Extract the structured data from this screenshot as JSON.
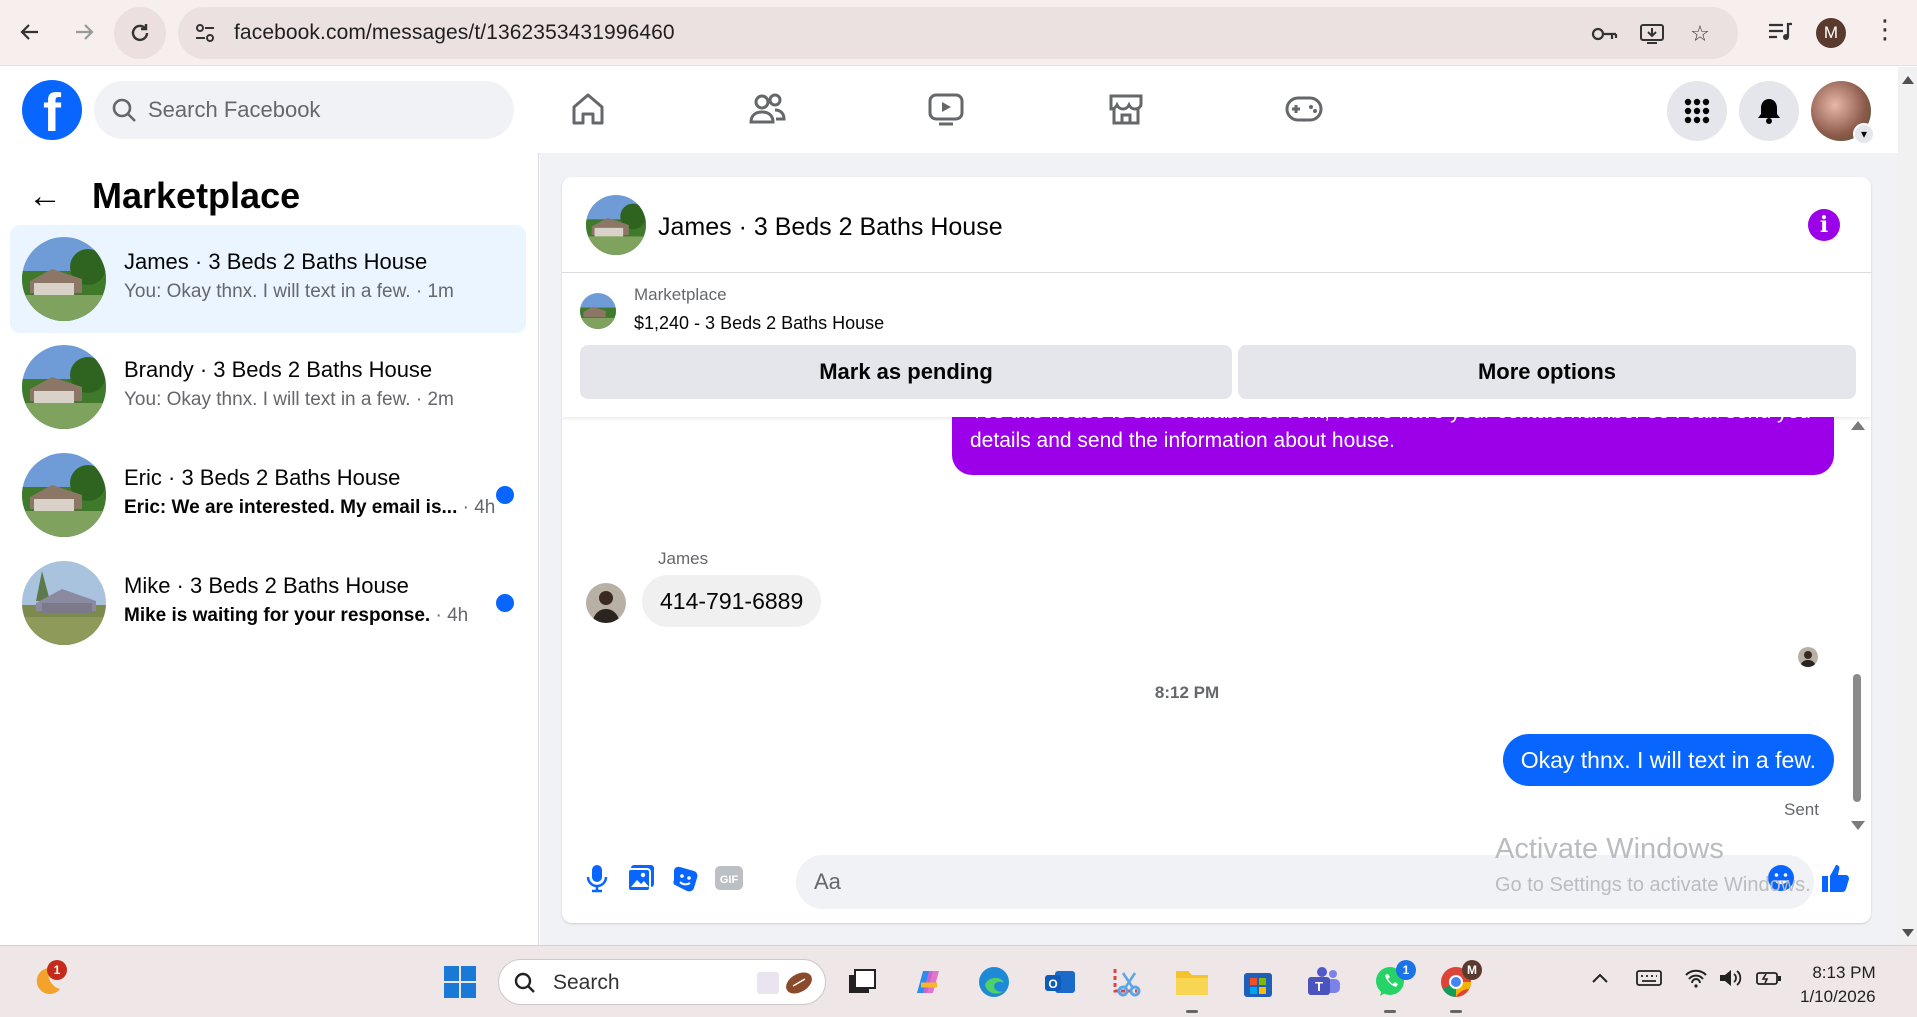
{
  "browser": {
    "url": "facebook.com/messages/t/1362353431996460",
    "profile_initial": "M"
  },
  "header": {
    "search_placeholder": "Search Facebook"
  },
  "sidebar": {
    "title": "Marketplace",
    "conversations": [
      {
        "name": "James · 3 Beds 2 Baths House",
        "snippet": "You: Okay thnx. I will text in a few.",
        "time": " · 1m",
        "unread": false,
        "active": true
      },
      {
        "name": "Brandy · 3 Beds 2 Baths House",
        "snippet": "You: Okay thnx. I will text in a few.",
        "time": " · 2m",
        "unread": false,
        "active": false
      },
      {
        "name": "Eric · 3 Beds 2 Baths House",
        "snippet": "Eric: We are interested. My email is...",
        "time": " · 4h",
        "unread": true,
        "active": false
      },
      {
        "name": "Mike · 3 Beds 2 Baths House",
        "snippet": "Mike is waiting for your response.",
        "time": " · 4h",
        "unread": true,
        "active": false
      }
    ]
  },
  "chat": {
    "title": "James · 3 Beds 2 Baths House",
    "marketplace_label": "Marketplace",
    "listing": "$1,240 - 3 Beds 2 Baths House",
    "mark_pending_label": "Mark as pending",
    "more_options_label": "More options",
    "messages": {
      "outgoing_1": "Yes this house is still available for rent, let me have your contact number so i can send you details and send the information about house.",
      "sender_name": "James",
      "incoming_1": "414-791-6889",
      "timestamp": "8:12 PM",
      "outgoing_2": "Okay thnx. I will text in a few.",
      "status": "Sent"
    },
    "composer_placeholder": "Aa"
  },
  "watermark": {
    "line1": "Activate Windows",
    "line2": "Go to Settings to activate Windows."
  },
  "taskbar": {
    "search_label": "Search",
    "time": "8:13 PM",
    "date": "1/10/2026",
    "weather_badge": "1",
    "whatsapp_badge": "1",
    "chrome_badge": "M"
  },
  "colors": {
    "fb_blue": "#0866ff",
    "purple_bubble": "#9b00e8",
    "active_conv_bg": "#ebf5ff"
  }
}
